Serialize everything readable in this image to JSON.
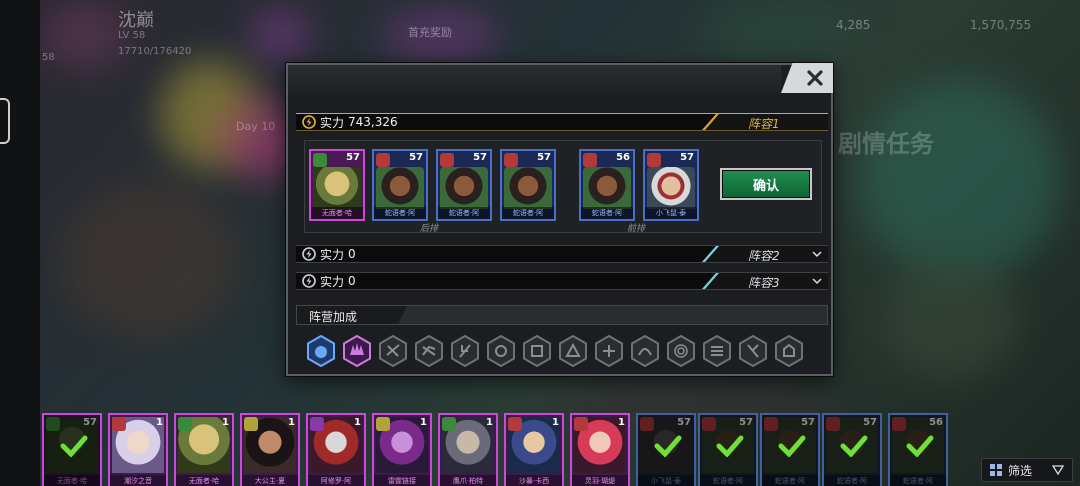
{
  "background": {
    "player_name": "沈巅",
    "player_level_line": "LV 58",
    "player_exp": "17710/176420",
    "player_level_short": "58",
    "badge_text": "首充奖励",
    "resource_1": "4,285",
    "resource_2": "1,570,755",
    "day_text": "Day 10",
    "plot_text": "剧情任务"
  },
  "modal": {
    "close_icon": "close-icon",
    "teams": [
      {
        "power_label": "实力",
        "power_value": "743,326",
        "team_label": "阵容1",
        "active": true
      },
      {
        "power_label": "实力",
        "power_value": "0",
        "team_label": "阵容2",
        "active": false
      },
      {
        "power_label": "实力",
        "power_value": "0",
        "team_label": "阵容3",
        "active": false
      }
    ],
    "formation": {
      "back_row_label": "后排",
      "front_row_label": "前排",
      "heroes": [
        {
          "name": "无面者·哈",
          "level": "57",
          "rarity": "purple",
          "faction": "green"
        },
        {
          "name": "蛇语者·阿",
          "level": "57",
          "rarity": "blue",
          "faction": "red"
        },
        {
          "name": "蛇语者·阿",
          "level": "57",
          "rarity": "blue",
          "faction": "red"
        },
        {
          "name": "蛇语者·阿",
          "level": "57",
          "rarity": "blue",
          "faction": "red"
        },
        {
          "name": "蛇语者·阿",
          "level": "56",
          "rarity": "blue",
          "faction": "red"
        },
        {
          "name": "小飞鼠·泰",
          "level": "57",
          "rarity": "blue",
          "faction": "red"
        }
      ]
    },
    "confirm_label": "确认",
    "bonus_label": "阵营加成",
    "faction_icons": [
      "blue-cat-icon",
      "purple-spiky-icon",
      "faction-icon-3",
      "faction-icon-4",
      "faction-icon-5",
      "faction-icon-6",
      "faction-icon-7",
      "faction-icon-8",
      "faction-icon-9",
      "faction-icon-10",
      "faction-icon-11",
      "faction-icon-12",
      "faction-icon-13",
      "faction-icon-14"
    ]
  },
  "roster": [
    {
      "name": "无面者·哈",
      "level": "57",
      "rarity": "purple",
      "selected": true
    },
    {
      "name": "潮汐之音",
      "level": "1",
      "rarity": "purple",
      "selected": false
    },
    {
      "name": "无面者·哈",
      "level": "1",
      "rarity": "purple",
      "selected": false
    },
    {
      "name": "大公主·夏",
      "level": "1",
      "rarity": "purple",
      "selected": false
    },
    {
      "name": "阿修罗·阿",
      "level": "1",
      "rarity": "purple",
      "selected": false
    },
    {
      "name": "雷霆链接",
      "level": "1",
      "rarity": "purple",
      "selected": false
    },
    {
      "name": "鹰爪·柏特",
      "level": "1",
      "rarity": "purple",
      "selected": false
    },
    {
      "name": "沙暴·卡西",
      "level": "1",
      "rarity": "purple",
      "selected": false
    },
    {
      "name": "灵羽·瑚缇",
      "level": "1",
      "rarity": "purple",
      "selected": false
    },
    {
      "name": "小飞鼠·泰",
      "level": "57",
      "rarity": "blue",
      "selected": true
    },
    {
      "name": "蛇语者·阿",
      "level": "57",
      "rarity": "blue",
      "selected": true
    },
    {
      "name": "蛇语者·阿",
      "level": "57",
      "rarity": "blue",
      "selected": true
    },
    {
      "name": "蛇语者·阿",
      "level": "57",
      "rarity": "blue",
      "selected": true
    },
    {
      "name": "蛇语者·阿",
      "level": "56",
      "rarity": "blue",
      "selected": true
    }
  ],
  "filter_label": "筛选",
  "colors": {
    "gold": "#e4b33e",
    "cyan": "#7ad3e0",
    "green_button": "#1f8f4e",
    "purple_rarity": "#c84ad6",
    "blue_rarity": "#4a6fc8"
  }
}
